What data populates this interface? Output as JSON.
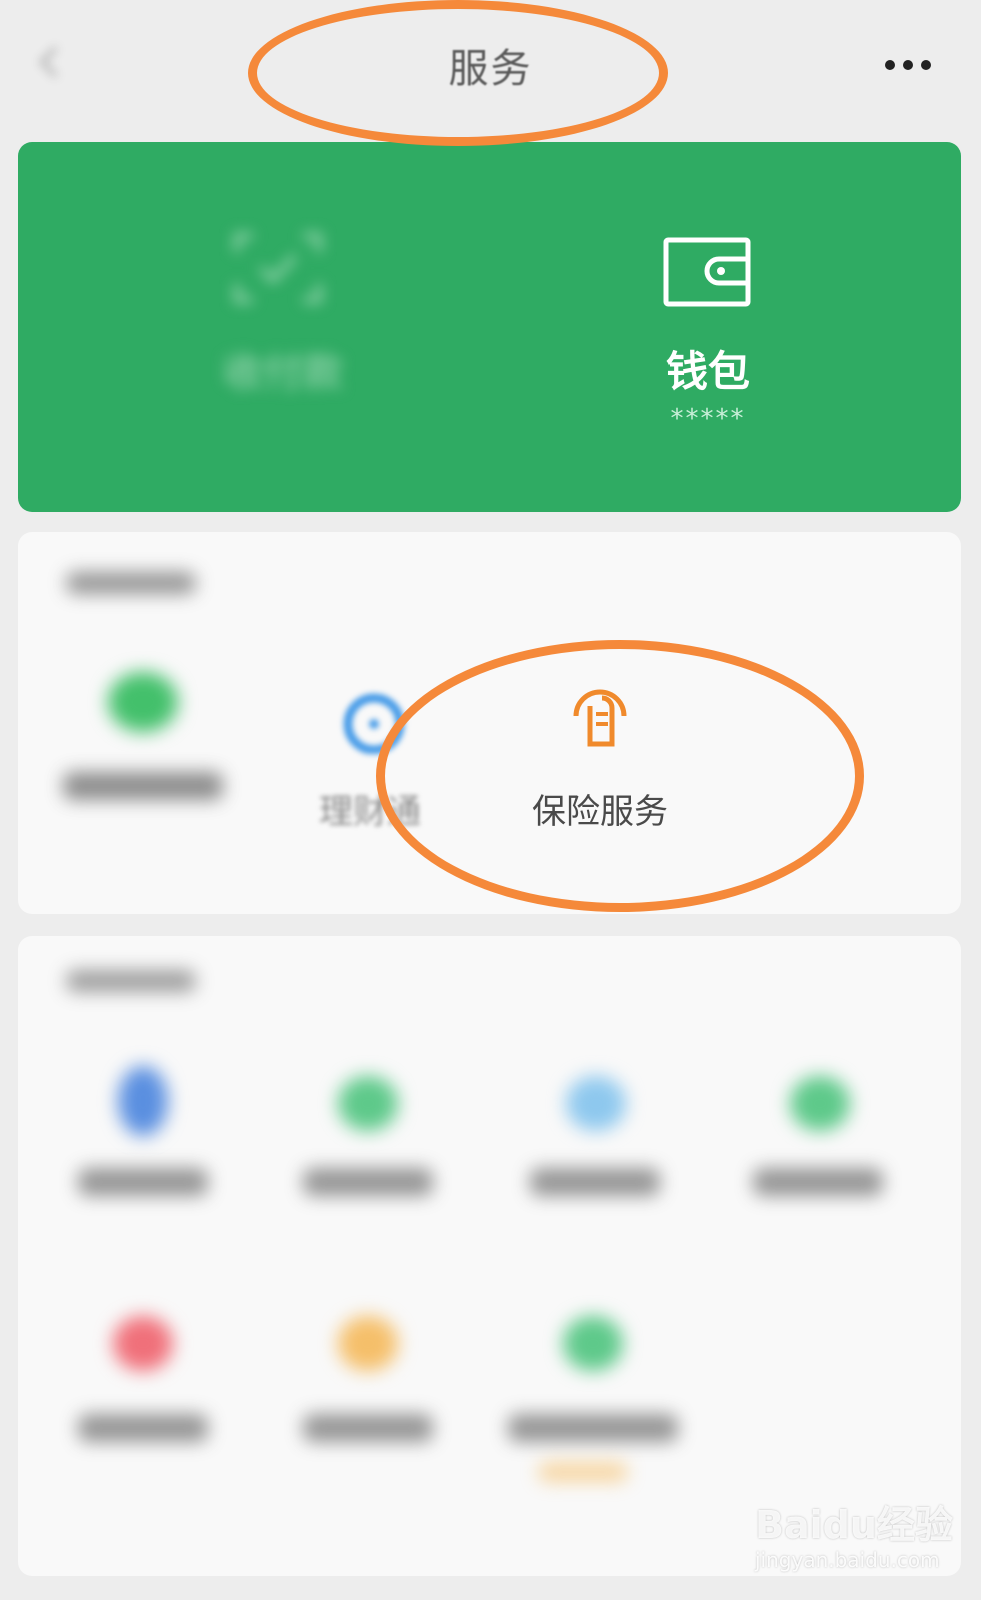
{
  "header": {
    "title": "服务"
  },
  "banner": {
    "pay_label": "收付款",
    "wallet_label": "钱包",
    "wallet_balance": "*****"
  },
  "section1": {
    "items": [
      {
        "label": "理财通",
        "icon": "licaitong-icon"
      },
      {
        "label": "保险服务",
        "icon": "insurance-icon"
      }
    ]
  },
  "watermark": {
    "logo": "Baidu经验",
    "url": "jingyan.baidu.com"
  },
  "colors": {
    "banner_green": "#2fab63",
    "annotation_orange": "#f5893a",
    "insurance_orange": "#f08a2c"
  }
}
